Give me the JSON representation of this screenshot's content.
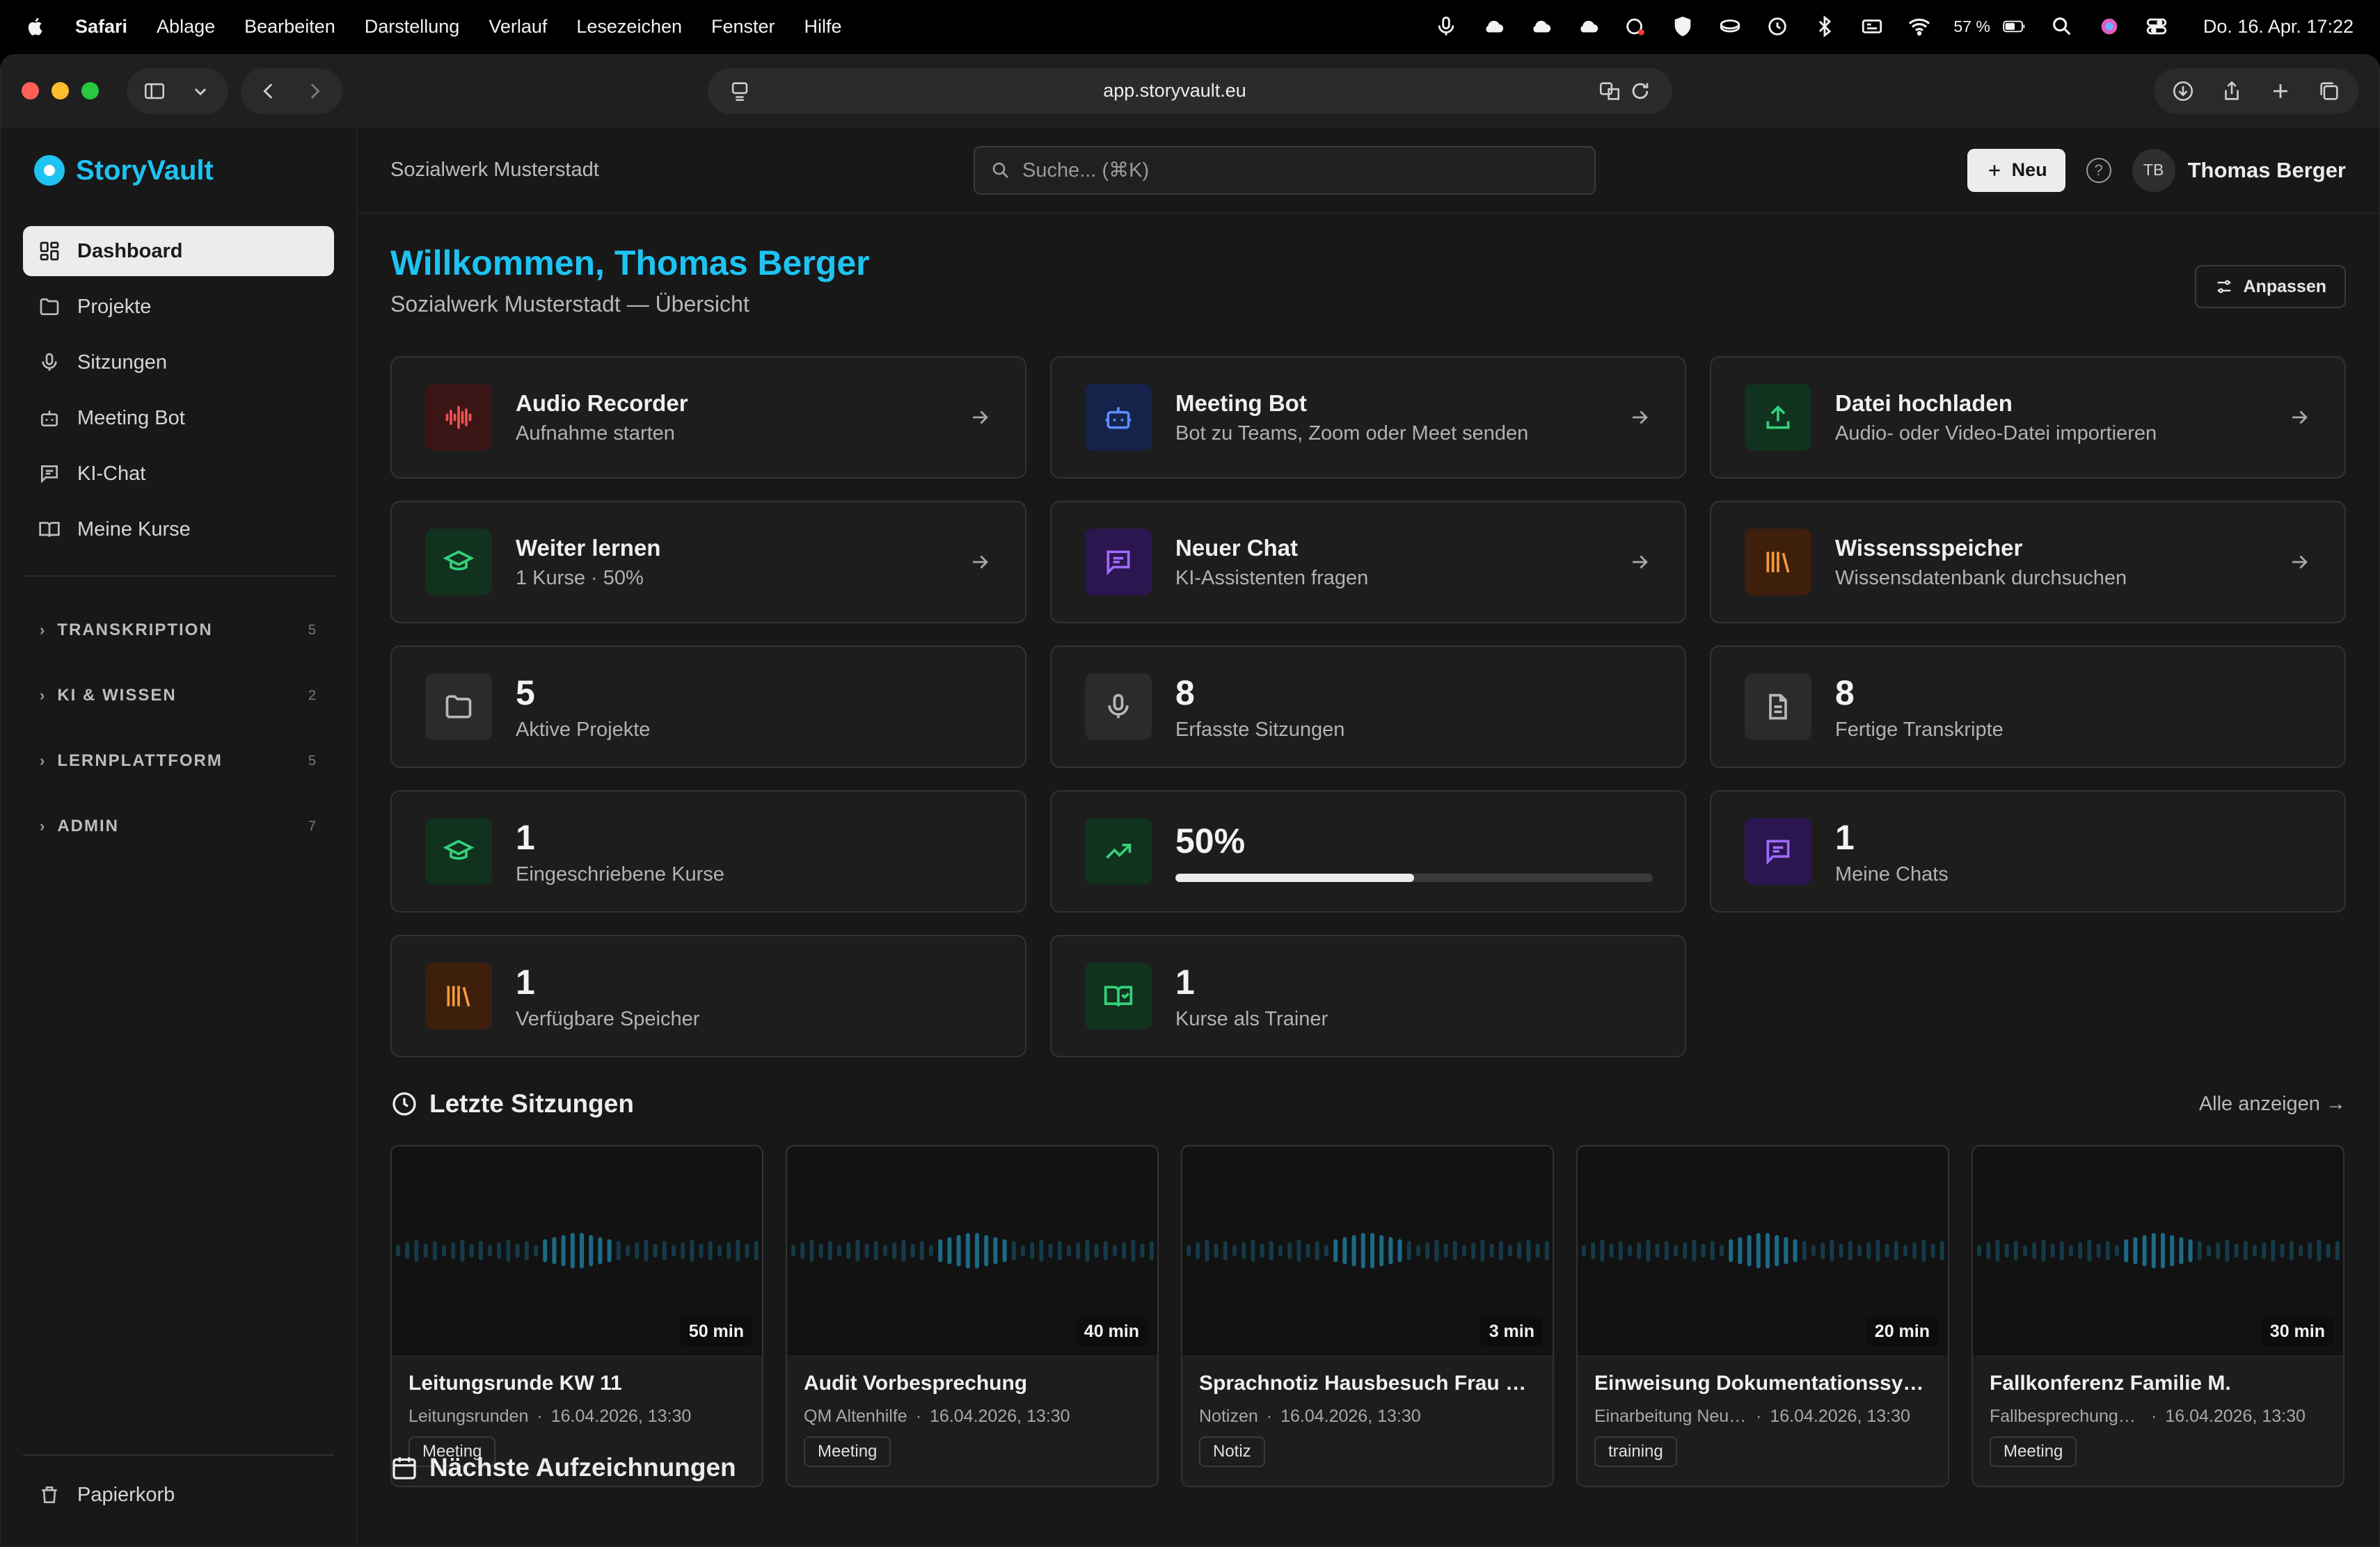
{
  "menubar": {
    "app": "Safari",
    "items": [
      "Ablage",
      "Bearbeiten",
      "Darstellung",
      "Verlauf",
      "Lesezeichen",
      "Fenster",
      "Hilfe"
    ],
    "battery": "57 %",
    "clock": "Do. 16. Apr.  17:22"
  },
  "browser": {
    "url": "app.storyvault.eu"
  },
  "sidebar": {
    "brand": "StoryVault",
    "nav": [
      {
        "label": "Dashboard",
        "icon": "dashboard-icon"
      },
      {
        "label": "Projekte",
        "icon": "folder-icon"
      },
      {
        "label": "Sitzungen",
        "icon": "microphone-icon"
      },
      {
        "label": "Meeting Bot",
        "icon": "bot-icon"
      },
      {
        "label": "KI-Chat",
        "icon": "chat-icon"
      },
      {
        "label": "Meine Kurse",
        "icon": "book-icon"
      }
    ],
    "sections": [
      {
        "label": "TRANSKRIPTION",
        "count": "5"
      },
      {
        "label": "KI & WISSEN",
        "count": "2"
      },
      {
        "label": "LERNPLATTFORM",
        "count": "5"
      },
      {
        "label": "ADMIN",
        "count": "7"
      }
    ],
    "trash": "Papierkorb"
  },
  "topbar": {
    "org": "Sozialwerk Musterstadt",
    "search_placeholder": "Suche... (⌘K)",
    "new_label": "Neu",
    "help": "?",
    "initials": "TB",
    "user": "Thomas Berger"
  },
  "header": {
    "welcome": "Willkommen, Thomas Berger",
    "subtitle": "Sozialwerk Musterstadt — Übersicht",
    "customize": "Anpassen"
  },
  "actions": [
    {
      "title": "Audio Recorder",
      "desc": "Aufnahme starten",
      "icon": "waveform-icon",
      "bg": "#3b1416",
      "fg": "#ef5350"
    },
    {
      "title": "Meeting Bot",
      "desc": "Bot zu Teams, Zoom oder Meet senden",
      "icon": "bot-icon",
      "bg": "#15224a",
      "fg": "#5b8cff"
    },
    {
      "title": "Datei hochladen",
      "desc": "Audio- oder Video-Datei importieren",
      "icon": "upload-icon",
      "bg": "#10321f",
      "fg": "#34d27a"
    },
    {
      "title": "Weiter lernen",
      "desc": "1 Kurse · 50%",
      "icon": "graduation-cap-icon",
      "bg": "#10321f",
      "fg": "#34d27a"
    },
    {
      "title": "Neuer Chat",
      "desc": "KI-Assistenten fragen",
      "icon": "chat-icon",
      "bg": "#2b1650",
      "fg": "#a06bff"
    },
    {
      "title": "Wissensspeicher",
      "desc": "Wissensdatenbank durchsuchen",
      "icon": "library-icon",
      "bg": "#3d1f0c",
      "fg": "#f59b3c"
    }
  ],
  "stats": [
    {
      "value": "5",
      "label": "Aktive Projekte",
      "icon": "folder-icon",
      "bg": "#2b2b2b",
      "fg": "#b8b8b8"
    },
    {
      "value": "8",
      "label": "Erfasste Sitzungen",
      "icon": "microphone-icon",
      "bg": "#2b2b2b",
      "fg": "#b8b8b8"
    },
    {
      "value": "8",
      "label": "Fertige Transkripte",
      "icon": "document-icon",
      "bg": "#2b2b2b",
      "fg": "#b8b8b8"
    },
    {
      "value": "1",
      "label": "Eingeschriebene Kurse",
      "icon": "graduation-cap-icon",
      "bg": "#10321f",
      "fg": "#34d27a"
    },
    {
      "value": "50%",
      "label": "",
      "icon": "trending-up-icon",
      "bg": "#10321f",
      "fg": "#34d27a",
      "progress": 0.5
    },
    {
      "value": "1",
      "label": "Meine Chats",
      "icon": "chat-icon",
      "bg": "#2b1650",
      "fg": "#a06bff"
    },
    {
      "value": "1",
      "label": "Verfügbare Speicher",
      "icon": "library-icon",
      "bg": "#3d1f0c",
      "fg": "#f59b3c"
    },
    {
      "value": "1",
      "label": "Kurse als Trainer",
      "icon": "book-check-icon",
      "bg": "#10321f",
      "fg": "#34d27a"
    }
  ],
  "recent": {
    "title": "Letzte Sitzungen",
    "see_all": "Alle anzeigen →",
    "items": [
      {
        "duration": "50 min",
        "title": "Leitungsrunde KW 11",
        "project": "Leitungsrunden",
        "date": "16.04.2026, 13:30",
        "tag": "Meeting"
      },
      {
        "duration": "40 min",
        "title": "Audit Vorbesprechung",
        "project": "QM Altenhilfe",
        "date": "16.04.2026, 13:30",
        "tag": "Meeting"
      },
      {
        "duration": "3 min",
        "title": "Sprachnotiz Hausbesuch Frau Sc...",
        "project": "Notizen",
        "date": "16.04.2026, 13:30",
        "tag": "Notiz"
      },
      {
        "duration": "20 min",
        "title": "Einweisung Dokumentationssystem",
        "project": "Einarbeitung Neue ...",
        "date": "16.04.2026, 13:30",
        "tag": "training"
      },
      {
        "duration": "30 min",
        "title": "Fallkonferenz Familie M.",
        "project": "Fallbesprechungen...",
        "date": "16.04.2026, 13:30",
        "tag": "Meeting"
      }
    ]
  },
  "next": {
    "title": "Nächste Aufzeichnungen"
  }
}
